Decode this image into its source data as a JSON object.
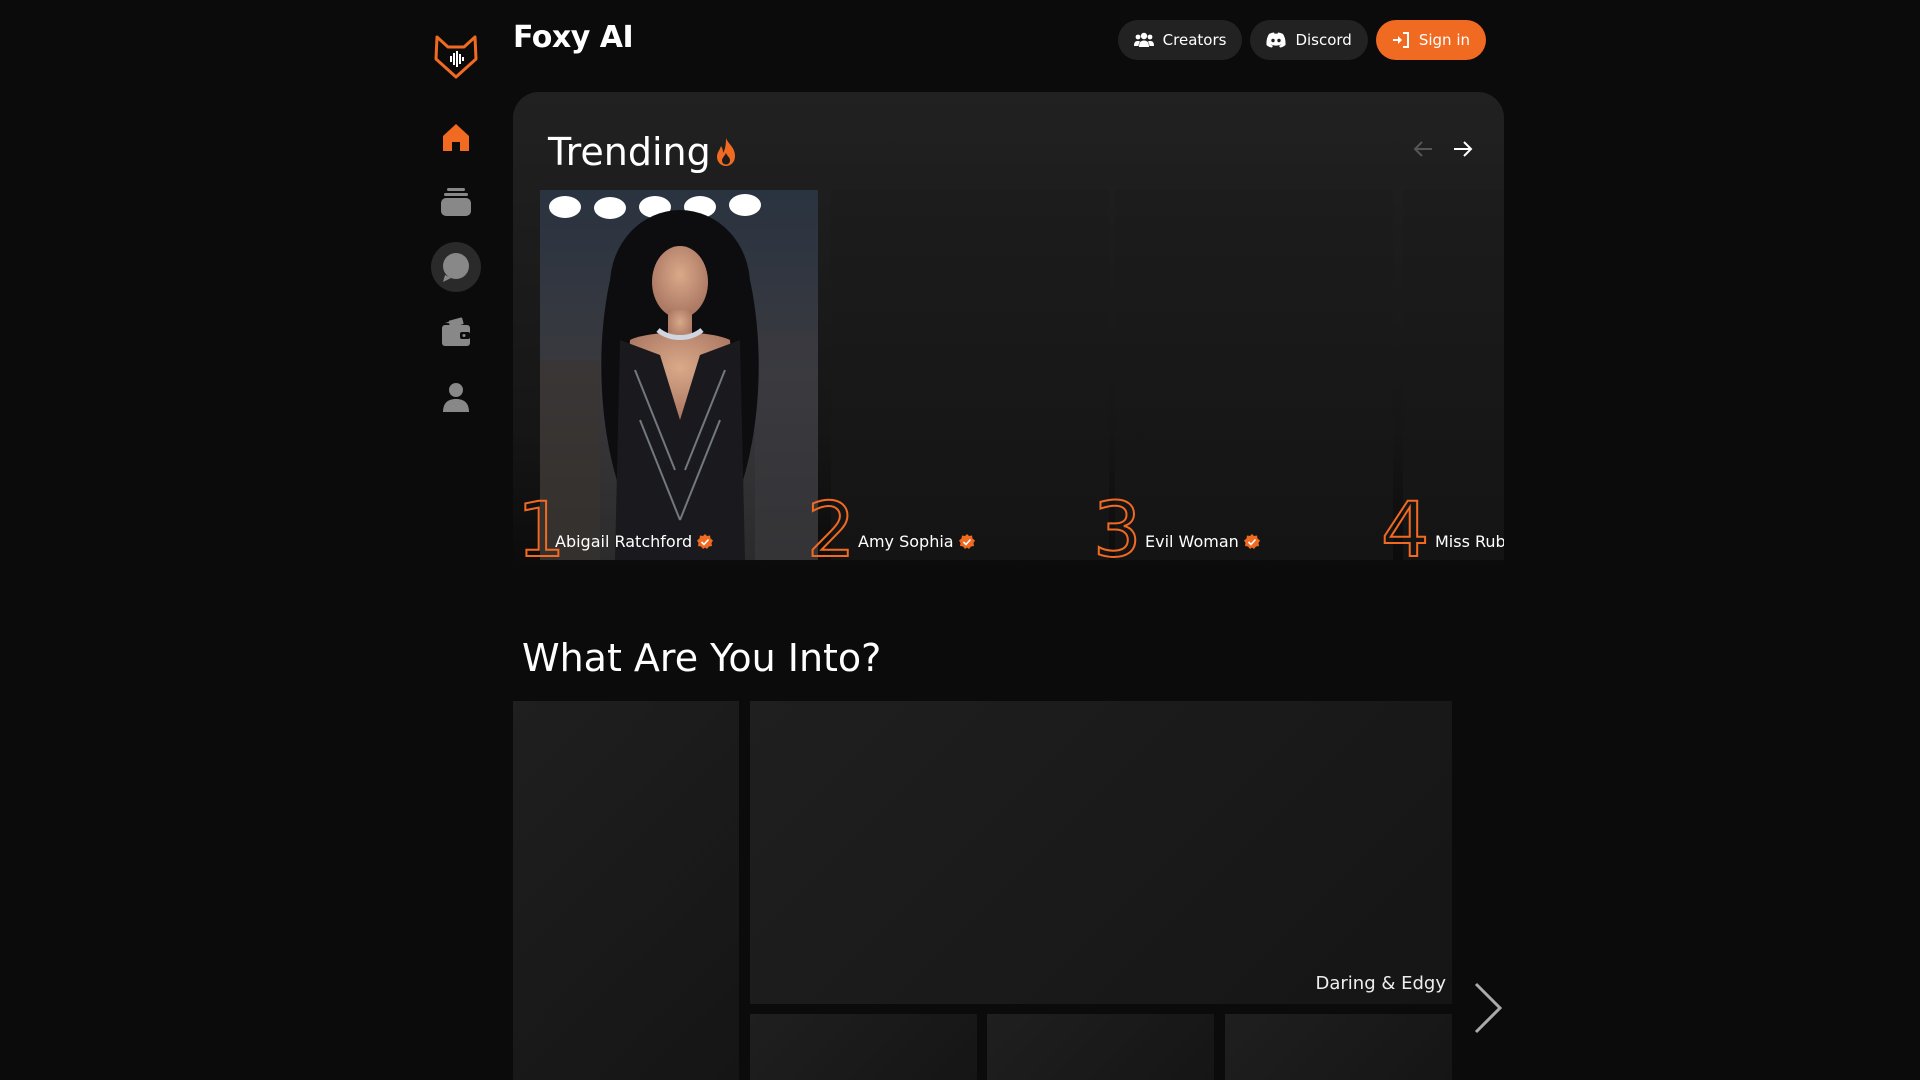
{
  "brand": {
    "name": "Foxy AI"
  },
  "header": {
    "creators_label": "Creators",
    "discord_label": "Discord",
    "signin_label": "Sign in"
  },
  "sidebar": {
    "items": [
      {
        "icon": "home-icon"
      },
      {
        "icon": "layers-icon"
      },
      {
        "icon": "chat-icon"
      },
      {
        "icon": "wallet-icon"
      },
      {
        "icon": "user-icon"
      }
    ]
  },
  "trending": {
    "title": "Trending",
    "cards": [
      {
        "rank": "1",
        "name": "Abigail Ratchford"
      },
      {
        "rank": "2",
        "name": "Amy Sophia"
      },
      {
        "rank": "3",
        "name": "Evil Woman"
      },
      {
        "rank": "4",
        "name": "Miss Ruby"
      }
    ]
  },
  "categories": {
    "title": "What Are You Into?",
    "featured_label": "Daring & Edgy"
  },
  "colors": {
    "accent": "#f16a22",
    "background": "#0b0b0b",
    "panel": "#212121"
  }
}
